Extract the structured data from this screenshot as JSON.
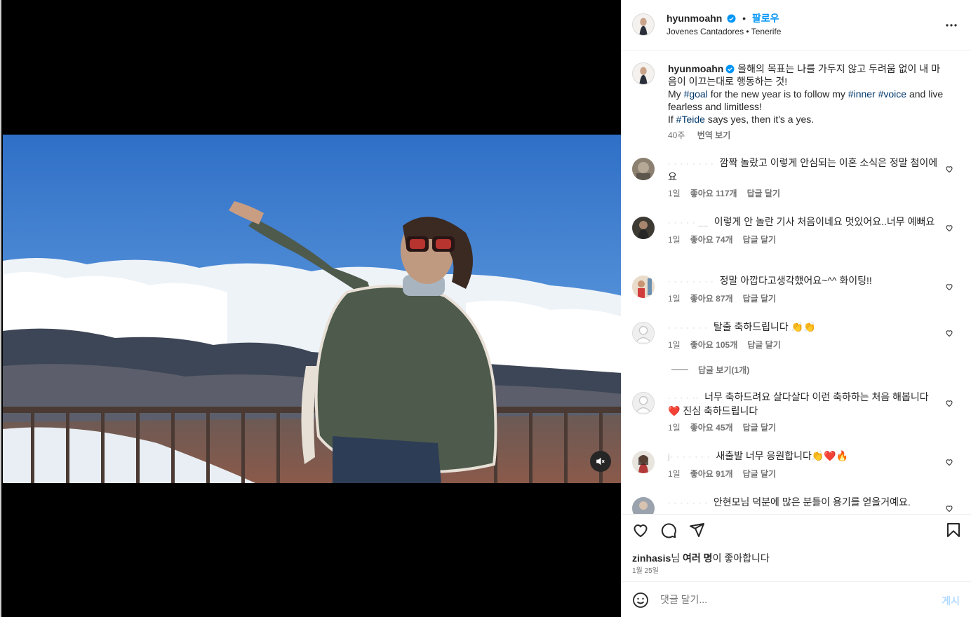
{
  "header": {
    "username": "hyunmoahn",
    "follow_label": "팔로우",
    "location": "Jovenes Cantadores • Tenerife"
  },
  "caption": {
    "username": "hyunmoahn",
    "korean": "올해의 목표는 나를 가두지 않고 두려움 없이 내 마음이 이끄는대로 행동하는 것!",
    "en_1a": "My ",
    "tag_goal": "#goal",
    "en_1b": " for the new year is to follow my ",
    "tag_inner": "#inner",
    "tag_voice": "#voice",
    "en_1c": " and live fearless and limitless!",
    "en_2a": "If ",
    "tag_teide": "#Teide",
    "en_2b": " says yes, then it's a yes.",
    "time": "40주",
    "translate": "번역 보기"
  },
  "comments": [
    {
      "name": "· ·  · ·  ·   ·  ·  ·",
      "text": "깜짝 놀랐고 이렇게 안심되는 이혼 소식은 정말 첨이에요",
      "time": "1일",
      "likes": "좋아요 117개",
      "reply": "답글 달기"
    },
    {
      "name": "·  · · · ·  __",
      "text": "이렇게 안 놀란 기사 처음이네요 멋있어요..너무 예뻐요",
      "time": "1일",
      "likes": "좋아요 74개",
      "reply": "답글 달기"
    },
    {
      "name": "·   · · · · ·  ·  ·",
      "text": "정말 아깝다고생각했어요~^^ 화이팅!!",
      "time": "1일",
      "likes": "좋아요 87개",
      "reply": "답글 달기"
    },
    {
      "name": "· ·  · · · · ·",
      "text": "탈출 축하드립니다 👏👏",
      "time": "1일",
      "likes": "좋아요 105개",
      "reply": "답글 달기"
    },
    {
      "name": "·  · ·  ·  ··",
      "text": "너무 축하드려요 살다살다 이런 축하하는 처음 해봅니다 ❤️ 진심 축하드립니다",
      "time": "1일",
      "likes": "좋아요 45개",
      "reply": "답글 달기"
    },
    {
      "name": "j·  · · · ·  ·  ·",
      "text": "새출발 너무 응원합니다👏❤️🔥",
      "time": "1일",
      "likes": "좋아요 91개",
      "reply": "답글 달기"
    },
    {
      "name": "· ·  · · ·  · ·",
      "text": "안현모님 덕분에 많은 분들이 용기를 얻을거예요.",
      "time": "",
      "likes": "",
      "reply": ""
    }
  ],
  "view_replies": "답글 보기(1개)",
  "likes_line": {
    "user": "zinhasis",
    "rest_1": "님 ",
    "bold_2": "여러 명",
    "rest_2": "이 좋아합니다"
  },
  "date": "1월 25일",
  "add_comment": {
    "placeholder": "댓글 달기...",
    "post_label": "게시"
  },
  "colors": {
    "accent": "#0095f6",
    "hashtag": "#00376b",
    "meta": "#737373"
  },
  "icons": [
    "verified-badge-icon",
    "more-options-icon",
    "heart-icon",
    "comment-icon",
    "share-icon",
    "bookmark-icon",
    "emoji-icon",
    "mute-icon"
  ]
}
